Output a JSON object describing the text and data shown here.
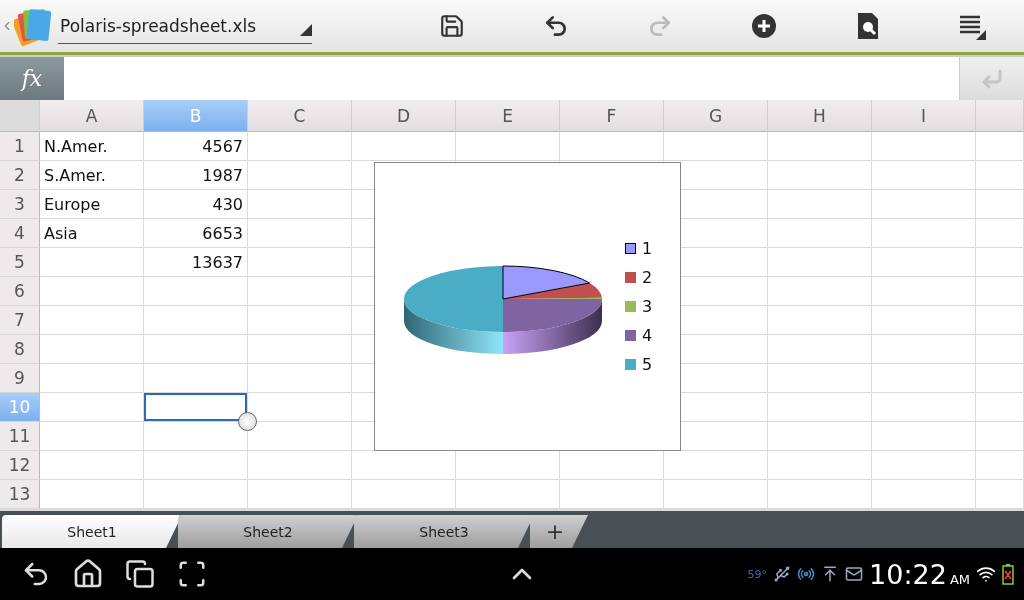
{
  "toolbar": {
    "file_name": "Polaris-spreadsheet.xls",
    "actions": [
      {
        "kind": "save",
        "disabled": false
      },
      {
        "kind": "undo",
        "disabled": false
      },
      {
        "kind": "redo",
        "disabled": true
      },
      {
        "kind": "insert",
        "disabled": false
      },
      {
        "kind": "tools",
        "disabled": false
      },
      {
        "kind": "menu",
        "disabled": false
      }
    ]
  },
  "formula_bar": {
    "label": "fx"
  },
  "columns": [
    {
      "label": "A",
      "selected": false
    },
    {
      "label": "B",
      "selected": true
    },
    {
      "label": "C",
      "selected": false
    },
    {
      "label": "D",
      "selected": false
    },
    {
      "label": "E",
      "selected": false
    },
    {
      "label": "F",
      "selected": false
    },
    {
      "label": "G",
      "selected": false
    },
    {
      "label": "H",
      "selected": false
    },
    {
      "label": "I",
      "selected": false
    }
  ],
  "rows": [
    {
      "number": "1",
      "selected": false,
      "cells": [
        {
          "text": "N.Amer."
        },
        {
          "text": "4567"
        }
      ]
    },
    {
      "number": "2",
      "selected": false,
      "cells": [
        {
          "text": "S.Amer."
        },
        {
          "text": "1987"
        }
      ]
    },
    {
      "number": "3",
      "selected": false,
      "cells": [
        {
          "text": "Europe"
        },
        {
          "text": "430"
        }
      ]
    },
    {
      "number": "4",
      "selected": false,
      "cells": [
        {
          "text": "Asia"
        },
        {
          "text": "6653"
        }
      ]
    },
    {
      "number": "5",
      "selected": false,
      "cells": [
        {},
        {
          "text": "13637"
        }
      ]
    },
    {
      "number": "6",
      "selected": false,
      "cells": []
    },
    {
      "number": "7",
      "selected": false,
      "cells": []
    },
    {
      "number": "8",
      "selected": false,
      "cells": []
    },
    {
      "number": "9",
      "selected": false,
      "cells": []
    },
    {
      "number": "10",
      "selected": true,
      "cells": [
        {},
        {
          "selected": true
        }
      ]
    },
    {
      "number": "11",
      "selected": false,
      "cells": []
    },
    {
      "number": "12",
      "selected": false,
      "cells": []
    },
    {
      "number": "13",
      "selected": false,
      "cells": []
    }
  ],
  "chart": {
    "legend": [
      {
        "label": "1",
        "color": "#9999ff"
      },
      {
        "label": "2",
        "color": "#c0504d"
      },
      {
        "label": "3",
        "color": "#9bbb59"
      },
      {
        "label": "4",
        "color": "#8064a2"
      },
      {
        "label": "5",
        "color": "#4bacc6"
      }
    ]
  },
  "sheet_tabs": [
    {
      "label": "Sheet1",
      "selected": true
    },
    {
      "label": "Sheet2",
      "selected": false
    },
    {
      "label": "Sheet3",
      "selected": false
    }
  ],
  "add_sheet": "+",
  "status_bar": {
    "temperature": "59°",
    "time": "10:22",
    "meridiem": "AM"
  }
}
